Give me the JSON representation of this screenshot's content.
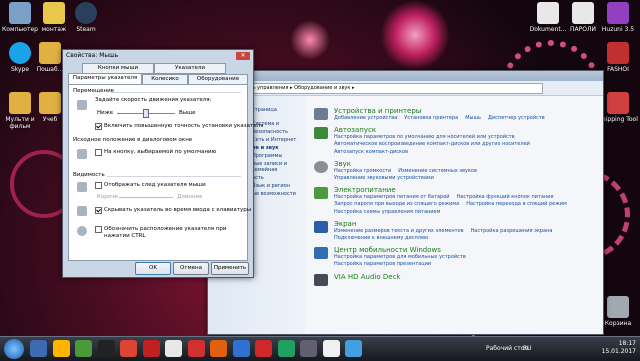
{
  "desktop": {
    "icons": [
      {
        "label": "Компьютер",
        "color": "#7aa0c8"
      },
      {
        "label": "монтаж",
        "color": "#e7c84a"
      },
      {
        "label": "Steam",
        "color": "#2a3f5e"
      },
      {
        "label": "Skype",
        "color": "#1aa3e8"
      },
      {
        "label": "Пошаб...",
        "color": "#e0b040"
      },
      {
        "label": "Мульти и фильм",
        "color": "#e0b040"
      },
      {
        "label": "Учеб",
        "color": "#e0b040"
      },
      {
        "label": "Dokument...",
        "color": "#e8e8e8"
      },
      {
        "label": "ПАРОЛИ",
        "color": "#e8e8e8"
      },
      {
        "label": "Huzuni 3.5",
        "color": "#9040c0"
      },
      {
        "label": "FASHOI",
        "color": "#c03030"
      },
      {
        "label": "Snipping Tool",
        "color": "#d04040"
      },
      {
        "label": "Корзина",
        "color": "#a0a8b0"
      }
    ]
  },
  "control_panel": {
    "breadcrumb": "Панель управления ▸ Оборудование и звук ▸",
    "sidebar": [
      "страница",
      "Система и",
      "безопасность",
      "Сеть и Интернет",
      "ие и звук",
      "Программы",
      "ные записи и семейная",
      "асть",
      "Язык и регион",
      "ые возможности"
    ],
    "categories": [
      {
        "title": "Устройства и принтеры",
        "icon_color": "#6a7d92",
        "links": [
          "Добавление устройства",
          "Установка принтера",
          "Мышь",
          "Диспетчер устройств"
        ]
      },
      {
        "title": "Автозапуск",
        "icon_color": "#3b8a3b",
        "links": [
          "Настройка параметров по умолчанию для носителей или устройств",
          "Автоматическое воспроизведение компакт-дисков или других носителей",
          "Автозапуск компакт-дисков"
        ]
      },
      {
        "title": "Звук",
        "icon_color": "#8a8f96",
        "links": [
          "Настройка громкости",
          "Изменение системных звуков",
          "Управление звуковыми устройствами"
        ]
      },
      {
        "title": "Электропитание",
        "icon_color": "#4c9a3c",
        "links": [
          "Настройка параметров питания от батарей",
          "Настройка функций кнопок питания",
          "Запрос пароля при выходе из спящего режима",
          "Настройка перехода в спящий режим",
          "Настройка схемы управления питанием"
        ]
      },
      {
        "title": "Экран",
        "icon_color": "#2b5da8",
        "links": [
          "Изменение размеров текста и других элементов",
          "Настройка разрешения экрана",
          "Подключение к внешнему дисплею"
        ]
      },
      {
        "title": "Центр мобильности Windows",
        "icon_color": "#2f6fb0",
        "links": [
          "Настройка параметров для мобильных устройств",
          "Настройка параметров презентации"
        ]
      },
      {
        "title": "VIA HD Audio Deck",
        "icon_color": "#444b55",
        "links": []
      }
    ]
  },
  "mouse_dialog": {
    "title": "Свойства: Мышь",
    "tabs_row1": [
      "Кнопки мыши",
      "Указатели"
    ],
    "tabs_row2": [
      "Параметры указателя",
      "Колесико",
      "Оборудование"
    ],
    "move_group": "Перемещение",
    "speed_label": "Задайте скорость движения указателя:",
    "slow": "Ниже",
    "fast": "Выше",
    "precision": "Включить повышенную точность установки указателя",
    "snap_group": "Исходное положение в диалоговом окне",
    "snap": "На кнопку, выбираемой по умолчанию",
    "vis_group": "Видимость",
    "trails": "Отображать след указателя мыши",
    "short": "Короче",
    "long": "Длиннее",
    "hide": "Скрывать указатель во время ввода с клавиатуры",
    "show_ctrl": "Обозначить расположение указателя при нажатии CTRL",
    "ok": "OK",
    "cancel": "Отмена",
    "apply": "Применить"
  },
  "taskbar": {
    "desktop_label": "Рабочий стол",
    "lang": "RU",
    "time": "18:17",
    "date": "15.01.2017",
    "app_colors": [
      "#3d6ab0",
      "#ffb400",
      "#4a9a3a",
      "#222222",
      "#dd4433",
      "#c02020",
      "#e8e8e8",
      "#d03030",
      "#e06010",
      "#3070d0",
      "#d02828",
      "#20a060",
      "#606070",
      "#f0f0f0",
      "#40a0e0"
    ]
  }
}
